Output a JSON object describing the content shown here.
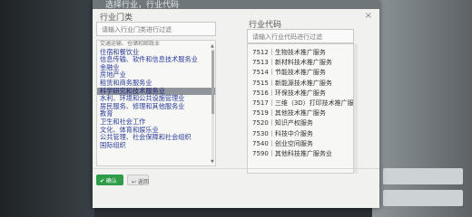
{
  "modal": {
    "title": "选择行业，行业代码",
    "left_title": "行业门类",
    "left_search_placeholder": "请输入行业门类进行过滤",
    "right_title": "行业代码",
    "right_search_placeholder": "请输入行业代码进行过滤",
    "close": "×"
  },
  "categories": [
    "交通运输、仓储和邮政业",
    "住宿和餐饮业",
    "信息传输、软件和信息技术服务业",
    "金融业",
    "房地产业",
    "租赁和商务服务业",
    "科学研究和技术服务业",
    "水利、环境和公共设施管理业",
    "居民服务、修理和其他服务业",
    "教育",
    "卫生和社会工作",
    "文化、体育和娱乐业",
    "公共管理、社会保障和社会组织",
    "国际组织"
  ],
  "selected_index": 6,
  "codes": [
    "7512｜生物技术推广服务",
    "7513｜新材料技术推广服务",
    "7514｜节能技术推广服务",
    "7515｜新能源技术推广服务",
    "7516｜环保技术推广服务",
    "7517｜三维（3D）打印技术推广服务",
    "7519｜其他技术推广服务",
    "7520｜知识产权服务",
    "7530｜科技中介服务",
    "7540｜创业空间服务",
    "7590｜其他科技推广服务业"
  ],
  "buttons": {
    "confirm": "✔ 确认",
    "back": "↩ 返回"
  },
  "colors": {
    "accent": "#2f9c4a",
    "link": "#2b3d9a",
    "selected_bg": "#8f959a"
  }
}
